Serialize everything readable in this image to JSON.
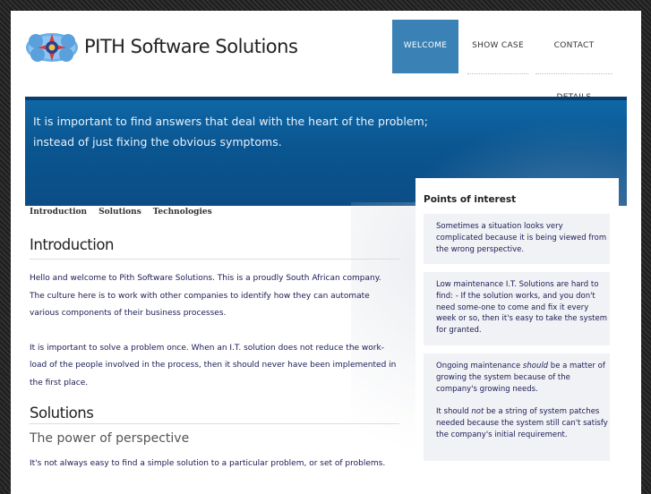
{
  "header": {
    "title": "PITH Software Solutions"
  },
  "nav": [
    {
      "label": "WELCOME PAGE",
      "active": true
    },
    {
      "label": "SHOW CASE",
      "active": false
    },
    {
      "label": "CONTACT DETAILS",
      "active": false
    }
  ],
  "banner": {
    "line1": "It is important to find answers that deal with the heart of the problem;",
    "line2": "instead of just fixing the obvious symptoms."
  },
  "subnav": [
    "Introduction",
    "Solutions",
    "Technologies"
  ],
  "introduction": {
    "heading": "Introduction",
    "p1": "Hello and welcome to Pith Software Solutions. This is a proudly South African company.",
    "p2": "The culture here is to work with other companies to identify how they can automate various components of their business processes.",
    "p3": "It is important to solve a problem once. When an I.T. solution does not reduce the work-load of the people involved in the process, then it should never have been implemented in the first place."
  },
  "solutions": {
    "heading": "Solutions",
    "subheading": "The power of perspective",
    "p1": "It's not always easy to find a simple solution to a particular problem, or set of problems."
  },
  "sidebar": {
    "heading": "Points of interest",
    "box1": "Sometimes a situation looks very complicated because it is being viewed from the wrong perspective.",
    "box2": "Low maintenance I.T. Solutions are hard to find: - If the solution works, and you don't need some-one to come and fix it every week or so, then it's easy to take the system for granted.",
    "box3a_pre": "Ongoing maintenance ",
    "box3a_em": "should",
    "box3a_post": " be a matter of growing the system because of the company's growing needs.",
    "box3b_pre": "It should ",
    "box3b_em": "not",
    "box3b_post": " be a string of system patches needed because the system still can't satisfy the company's initial requirement."
  },
  "colors": {
    "accent": "#3a82b6",
    "banner": "#0b5a96",
    "text": "#1a1a55"
  }
}
